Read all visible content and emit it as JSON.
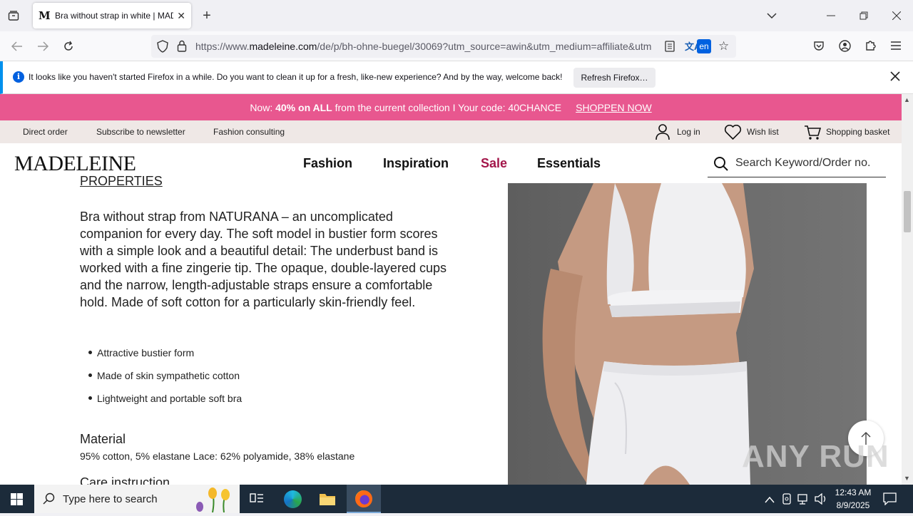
{
  "browser": {
    "tab_title": "Bra without strap in white | MADELEINE",
    "tab_favicon": "M",
    "url_prefix": "https://www.",
    "url_domain": "madeleine.com",
    "url_rest": "/de/p/bh-ohne-buegel/30069?utm_source=awin&utm_medium=affiliate&utm",
    "translate_badge": "en"
  },
  "notification": {
    "message": "It looks like you haven't started Firefox in a while. Do you want to clean it up for a fresh, like-new experience? And by the way, welcome back!",
    "button": "Refresh Firefox…"
  },
  "promo": {
    "pre": "Now: ",
    "bold": "40% on ALL",
    "post": " from the current collection I Your code: 40CHANCE",
    "link": "SHOPPEN NOW",
    "color": "#e8578f"
  },
  "topnav": {
    "direct_order": "Direct order",
    "newsletter": "Subscribe to newsletter",
    "consulting": "Fashion consulting",
    "login": "Log in",
    "wishlist": "Wish list",
    "basket": "Shopping basket"
  },
  "mainnav": {
    "logo": "MADELEINE",
    "items": [
      "Fashion",
      "Inspiration",
      "Sale",
      "Essentials"
    ],
    "sale_color": "#a3164a",
    "search_placeholder": "Search Keyword/Order no."
  },
  "product": {
    "properties_heading": "PROPERTIES",
    "description": "Bra without strap from NATURANA – an uncomplicated companion for every day. The soft model in bustier form scores with a simple look and a beautiful detail: The underbust band is worked with a fine zingerie tip. The opaque, double-layered cups and the narrow, length-adjustable straps ensure a comfortable hold. Made of soft cotton for a particularly skin-friendly feel.",
    "bullets": [
      "Attractive bustier form",
      "Made of skin sympathetic cotton",
      "Lightweight and portable soft bra"
    ],
    "material_heading": "Material",
    "material": "95% cotton, 5% elastane Lace: 62% polyamide, 38% elastane",
    "care_heading": "Care instruction"
  },
  "watermark": "ANY RUN",
  "taskbar": {
    "search_placeholder": "Type here to search",
    "time": "12:43 AM",
    "date": "8/9/2025"
  }
}
